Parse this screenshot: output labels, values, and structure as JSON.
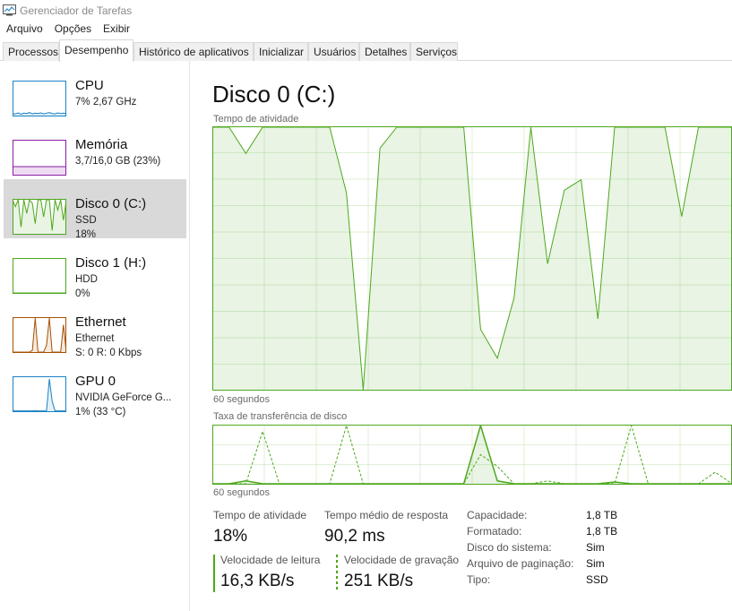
{
  "window": {
    "title": "Gerenciador de Tarefas"
  },
  "menu": [
    "Arquivo",
    "Opções",
    "Exibir"
  ],
  "tabs": [
    "Processos",
    "Desempenho",
    "Histórico de aplicativos",
    "Inicializar",
    "Usuários",
    "Detalhes",
    "Serviços"
  ],
  "active_tab": "Desempenho",
  "sidebar": [
    {
      "title": "CPU",
      "line1": "7% 2,67 GHz",
      "line2": "",
      "color": "#1b83c4"
    },
    {
      "title": "Memória",
      "line1": "3,7/16,0 GB (23%)",
      "line2": "",
      "color": "#8b1da5"
    },
    {
      "title": "Disco 0 (C:)",
      "line1": "SSD",
      "line2": "18%",
      "color": "#4da81d"
    },
    {
      "title": "Disco 1 (H:)",
      "line1": "HDD",
      "line2": "0%",
      "color": "#4da81d"
    },
    {
      "title": "Ethernet",
      "line1": "Ethernet",
      "line2": "S: 0 R: 0 Kbps",
      "color": "#a74f01"
    },
    {
      "title": "GPU 0",
      "line1": "NVIDIA GeForce G...",
      "line2": "1% (33 °C)",
      "color": "#1b83c4"
    }
  ],
  "selected_index": 2,
  "main": {
    "title": "Disco 0 (C:)",
    "activity_label": "Tempo de atividade",
    "activity_time_label": "60 segundos",
    "transfer_label": "Taxa de transferência de disco",
    "transfer_time_label": "60 segundos",
    "accent": "#4da81d",
    "activity_values": [
      100,
      100,
      90,
      100,
      100,
      100,
      100,
      100,
      75,
      0,
      92,
      100,
      100,
      100,
      100,
      100,
      23,
      12,
      35,
      100,
      48,
      76,
      80,
      27,
      100,
      100,
      100,
      100,
      66,
      100,
      100,
      100
    ],
    "transfer_read": [
      0,
      0,
      5,
      0,
      0,
      0,
      0,
      0,
      0,
      0,
      0,
      0,
      0,
      0,
      0,
      0,
      100,
      5,
      0,
      0,
      0,
      0,
      0,
      0,
      3,
      0,
      0,
      0,
      0,
      0,
      0,
      0
    ],
    "transfer_write": [
      0,
      0,
      0,
      90,
      0,
      0,
      0,
      0,
      100,
      0,
      0,
      0,
      0,
      0,
      0,
      0,
      50,
      30,
      0,
      0,
      5,
      0,
      0,
      0,
      0,
      100,
      0,
      0,
      0,
      0,
      20,
      0
    ]
  },
  "stats": {
    "activity": {
      "label": "Tempo de atividade",
      "value": "18%"
    },
    "response": {
      "label": "Tempo médio de resposta",
      "value": "90,2 ms"
    },
    "read": {
      "label": "Velocidade de leitura",
      "value": "16,3 KB/s"
    },
    "write": {
      "label": "Velocidade de gravação",
      "value": "251 KB/s"
    }
  },
  "info": [
    {
      "label": "Capacidade:",
      "value": "1,8 TB"
    },
    {
      "label": "Formatado:",
      "value": "1,8 TB"
    },
    {
      "label": "Disco do sistema:",
      "value": "Sim"
    },
    {
      "label": "Arquivo de paginação:",
      "value": "Sim"
    },
    {
      "label": "Tipo:",
      "value": "SSD"
    }
  ]
}
